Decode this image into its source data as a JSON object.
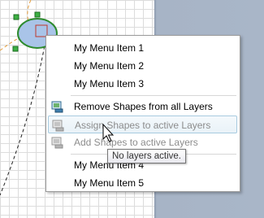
{
  "menu": {
    "items": [
      {
        "label": "My Menu Item 1",
        "enabled": true
      },
      {
        "label": "My Menu Item 2",
        "enabled": true
      },
      {
        "label": "My Menu Item 3",
        "enabled": true
      },
      {
        "label": "Remove Shapes from all Layers",
        "enabled": true,
        "icon": "layers-remove-icon"
      },
      {
        "label": "Assign Shapes to active Layers",
        "enabled": false,
        "icon": "layers-assign-icon",
        "highlighted": true
      },
      {
        "label": "Add Shapes to active Layers",
        "enabled": false,
        "icon": "layers-add-icon"
      },
      {
        "label": "My Menu Item 4",
        "enabled": true
      },
      {
        "label": "My Menu Item 5",
        "enabled": true
      }
    ]
  },
  "tooltip": {
    "text": "No layers active."
  },
  "colors": {
    "selection_green": "#2e8b2e",
    "shape_fill": "#a9c4e8",
    "hover_border": "#a8cbe0",
    "side_panel": "#a9b6c8"
  }
}
